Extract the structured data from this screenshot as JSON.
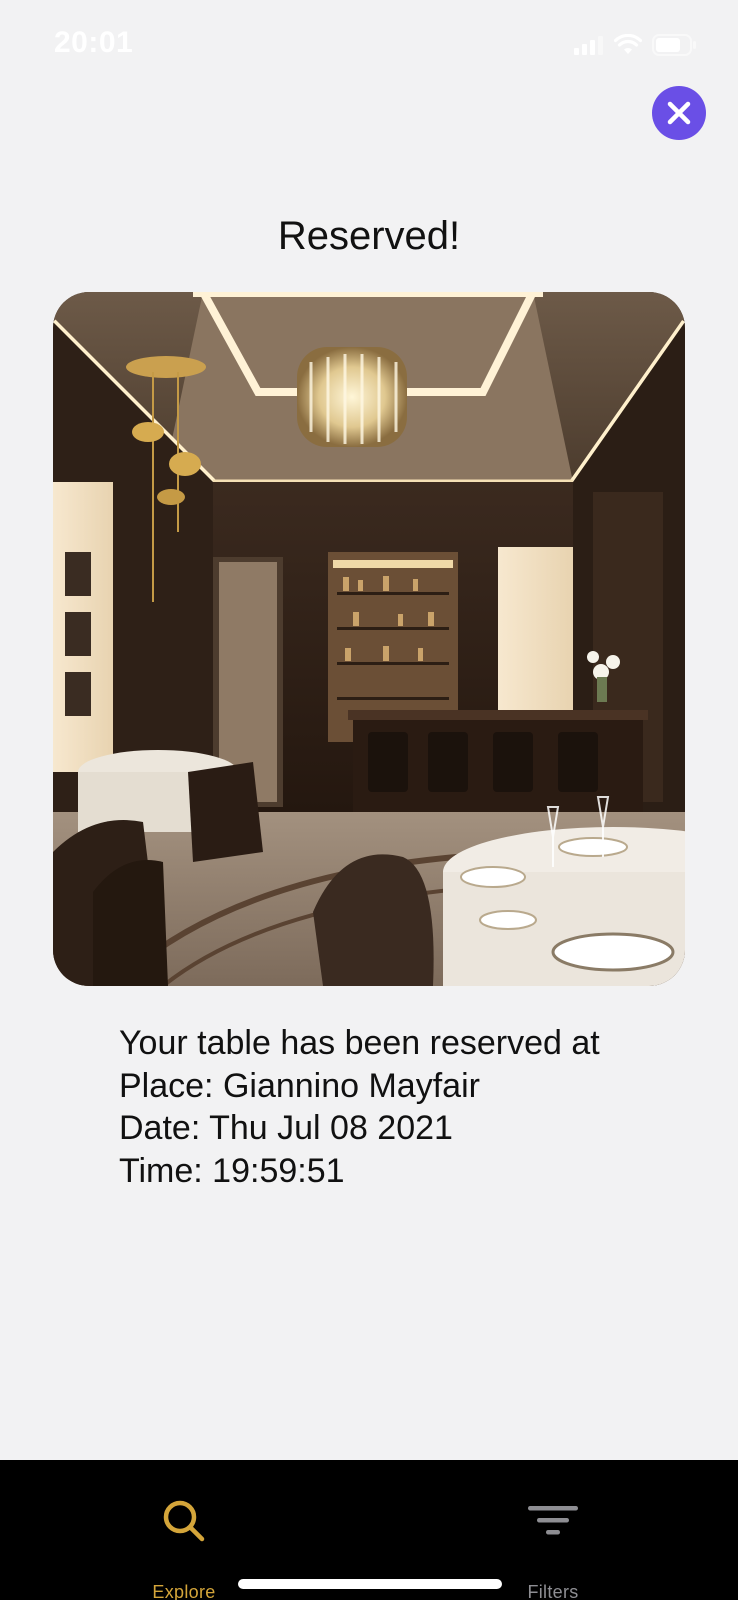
{
  "status_bar": {
    "time": "20:01",
    "icons": [
      "cellular-signal-icon",
      "wifi-icon",
      "battery-icon"
    ]
  },
  "close_button": {
    "icon": "close-icon",
    "color": "#6a4fe6"
  },
  "title": "Reserved!",
  "photo": {
    "subject": "restaurant-interior-photo"
  },
  "message": {
    "line1": "Your table has been reserved at",
    "line2": "Place: Giannino Mayfair",
    "line3": "Date: Thu Jul 08 2021",
    "line4": "Time: 19:59:51"
  },
  "tabbar": {
    "tabs": [
      {
        "label": "Explore",
        "icon": "search-icon",
        "active": true,
        "color": "#d4a53a"
      },
      {
        "label": "Filters",
        "icon": "filter-icon",
        "active": false,
        "color": "#8e8e93"
      }
    ]
  }
}
